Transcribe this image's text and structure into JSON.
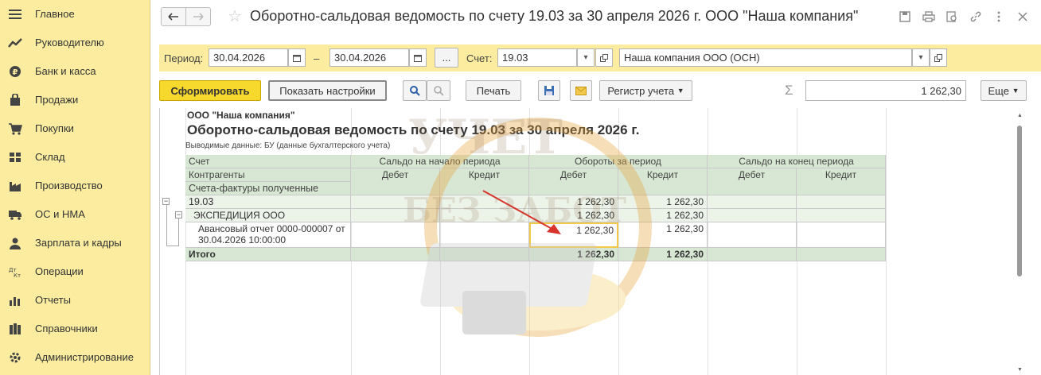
{
  "sidebar": {
    "items": [
      {
        "label": "Главное",
        "icon": "menu-icon"
      },
      {
        "label": "Руководителю",
        "icon": "trend-icon"
      },
      {
        "label": "Банк и касса",
        "icon": "coin-icon"
      },
      {
        "label": "Продажи",
        "icon": "bag-icon"
      },
      {
        "label": "Покупки",
        "icon": "cart-icon"
      },
      {
        "label": "Склад",
        "icon": "warehouse-icon"
      },
      {
        "label": "Производство",
        "icon": "factory-icon"
      },
      {
        "label": "ОС и НМА",
        "icon": "truck-icon"
      },
      {
        "label": "Зарплата и кадры",
        "icon": "person-icon"
      },
      {
        "label": "Операции",
        "icon": "dtkt-icon"
      },
      {
        "label": "Отчеты",
        "icon": "bar-chart-icon"
      },
      {
        "label": "Справочники",
        "icon": "books-icon"
      },
      {
        "label": "Администрирование",
        "icon": "gear-icon"
      }
    ]
  },
  "header": {
    "title": "Оборотно-сальдовая ведомость по счету 19.03 за 30 апреля 2026 г. ООО \"Наша компания\""
  },
  "period": {
    "label": "Период:",
    "from": "30.04.2026",
    "dash": "–",
    "to": "30.04.2026",
    "more": "...",
    "account_label": "Счет:",
    "account": "19.03",
    "org": "Наша компания ООО (ОСН)"
  },
  "toolbar": {
    "generate": "Сформировать",
    "settings": "Показать настройки",
    "print": "Печать",
    "register": "Регистр учета",
    "sum_symbol": "Σ",
    "sum_value": "1 262,30",
    "more": "Еще"
  },
  "report": {
    "org": "ООО \"Наша компания\"",
    "title": "Оборотно-сальдовая ведомость по счету 19.03 за 30 апреля 2026 г.",
    "data_shown": "Выводимые данные: БУ (данные бухгалтерского учета)",
    "headers": {
      "account": "Счет",
      "counterparties": "Контрагенты",
      "invoices": "Счета-фактуры полученные",
      "opening": "Сальдо на начало периода",
      "turnover": "Обороты за период",
      "closing": "Сальдо на конец периода",
      "debit": "Дебет",
      "credit": "Кредит"
    },
    "rows": [
      {
        "name": "19.03",
        "turn_debit": "1 262,30",
        "turn_credit": "1 262,30"
      },
      {
        "name": "ЭКСПЕДИЦИЯ ООО",
        "turn_debit": "1 262,30",
        "turn_credit": "1 262,30"
      },
      {
        "name": "Авансовый отчет 0000-000007 от 30.04.2026 10:00:00",
        "name_l1": "Авансовый отчет 0000-000007 от",
        "name_l2": "30.04.2026 10:00:00",
        "turn_debit": "1 262,30",
        "turn_credit": "1 262,30"
      }
    ],
    "total": {
      "name": "Итого",
      "turn_debit": "1 262,30",
      "turn_credit": "1 262,30"
    }
  },
  "watermark": {
    "line1": "УЧЕТ",
    "line2": "БЕЗ ЗАБОТ"
  },
  "colors": {
    "sidebar": "#fbec9f",
    "primary_button": "#f7d82c",
    "table_header": "#d8e7d3",
    "arrow": "#d9342b"
  }
}
